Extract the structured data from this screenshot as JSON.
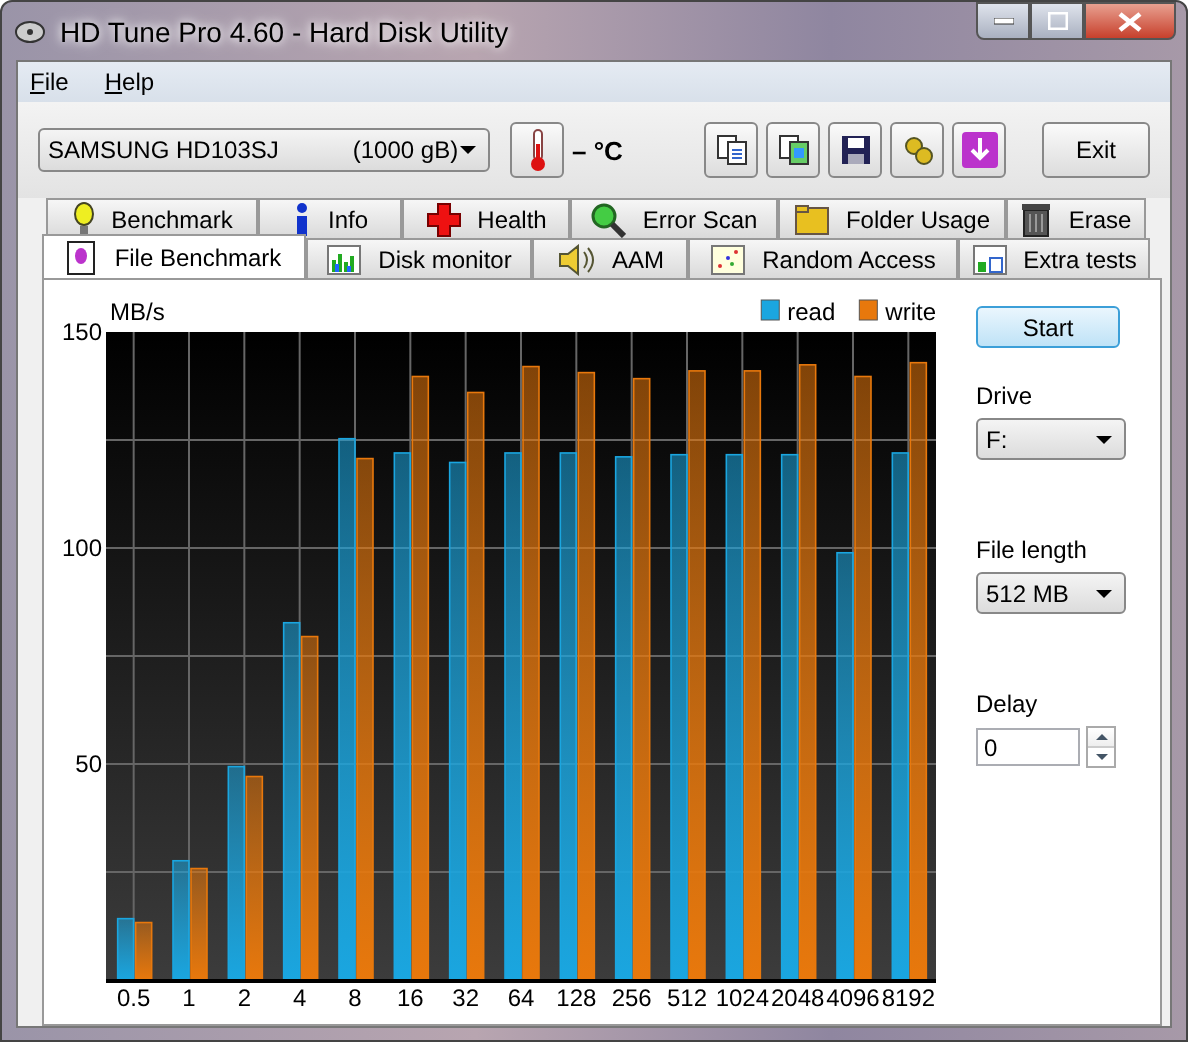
{
  "window": {
    "title": "HD Tune Pro 4.60 - Hard Disk Utility"
  },
  "menu": [
    {
      "label": "File"
    },
    {
      "label": "Help"
    }
  ],
  "toolbar": {
    "drive": {
      "name": "SAMSUNG HD103SJ",
      "capacity": "(1000 gB)"
    },
    "temperature": "– °C",
    "exit": "Exit"
  },
  "tabs_back": [
    {
      "label": "Benchmark",
      "selected": false
    },
    {
      "label": "Info",
      "selected": false
    },
    {
      "label": "Health",
      "selected": false
    },
    {
      "label": "Error Scan",
      "selected": false
    },
    {
      "label": "Folder Usage",
      "selected": false
    },
    {
      "label": "Erase",
      "selected": false
    }
  ],
  "tabs_front": [
    {
      "label": "File Benchmark",
      "selected": true
    },
    {
      "label": "Disk monitor",
      "selected": false
    },
    {
      "label": "AAM",
      "selected": false
    },
    {
      "label": "Random Access",
      "selected": false
    },
    {
      "label": "Extra tests",
      "selected": false
    }
  ],
  "chart_data": {
    "type": "bar",
    "ylabel": "MB/s",
    "grid": true,
    "legend": true,
    "ylim": [
      0,
      150
    ],
    "yticks": [
      50,
      100,
      150
    ],
    "categories": [
      "0.5",
      "1",
      "2",
      "4",
      "8",
      "16",
      "32",
      "64",
      "128",
      "256",
      "512",
      "1024",
      "2048",
      "4096",
      "8192"
    ],
    "series": [
      {
        "name": "read",
        "color": "#1aa6e0",
        "values": [
          14.2,
          27.6,
          49.4,
          82.7,
          125.3,
          122,
          119.8,
          122,
          122,
          121.1,
          121.6,
          121.6,
          121.6,
          98.9,
          122
        ]
      },
      {
        "name": "write",
        "color": "#e8780c",
        "values": [
          13.3,
          25.8,
          47.1,
          79.5,
          120.7,
          139.7,
          136,
          142,
          140.6,
          139.2,
          141,
          141,
          142.4,
          139.7,
          142.9
        ]
      }
    ]
  },
  "side": {
    "start": "Start",
    "drive_label": "Drive",
    "drive_value": "F:",
    "length_label": "File length",
    "length_value": "512 MB",
    "delay_label": "Delay",
    "delay_value": "0"
  }
}
